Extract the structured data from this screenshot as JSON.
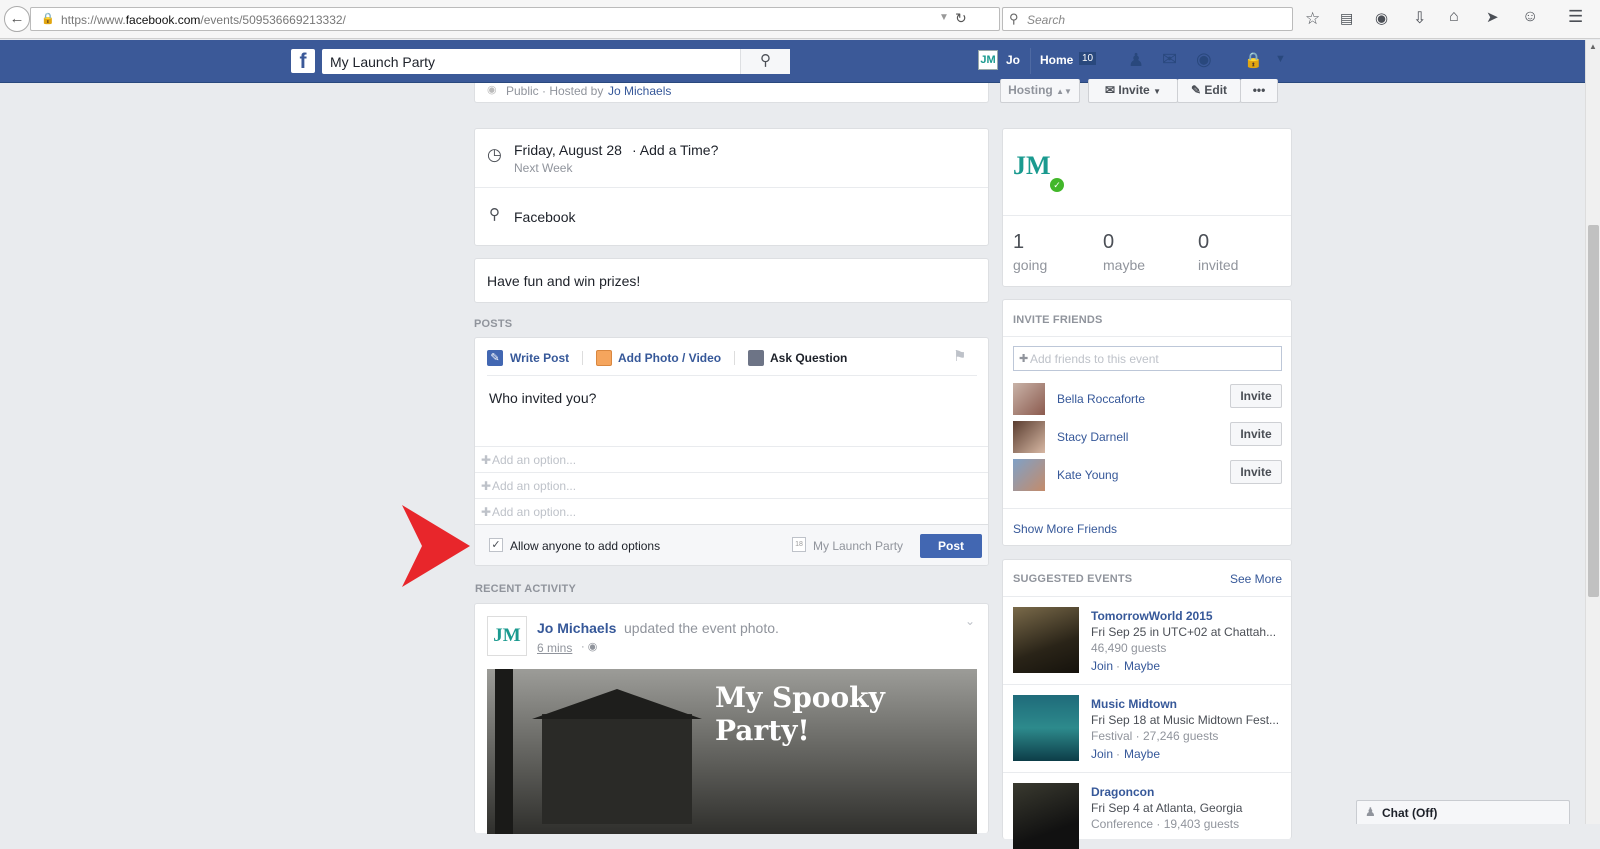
{
  "browser": {
    "url_prefix": "https://www.",
    "url_domain": "facebook.com",
    "url_path": "/events/509536669213332/",
    "search_placeholder": "Search"
  },
  "topbar": {
    "search_value": "My Launch Party",
    "user_name": "Jo",
    "home_label": "Home",
    "home_count": "10"
  },
  "event_header": {
    "privacy": "Public",
    "hosted_by_prefix": "· Hosted by",
    "host": "Jo Michaels",
    "hosting_label": "Hosting",
    "invite_label": "Invite",
    "edit_label": "Edit",
    "more_label": "•••"
  },
  "details": {
    "date": "Friday, August 28",
    "add_time": "· Add a Time?",
    "relative": "Next Week",
    "location": "Facebook",
    "description": "Have fun and win prizes!"
  },
  "posts": {
    "header": "POSTS",
    "tabs": [
      "Write Post",
      "Add Photo / Video",
      "Ask Question"
    ],
    "question": "Who invited you?",
    "option_placeholder": "Add an option...",
    "allow_label": "Allow anyone to add options",
    "target": "My Launch Party",
    "post_label": "Post"
  },
  "recent": {
    "header": "RECENT ACTIVITY",
    "author": "Jo Michaels",
    "action": "updated the event photo.",
    "time": "6 mins",
    "photo_text": "My Spooky Party!"
  },
  "stats": [
    {
      "count": "1",
      "label": "going"
    },
    {
      "count": "0",
      "label": "maybe"
    },
    {
      "count": "0",
      "label": "invited"
    }
  ],
  "invite_friends": {
    "header": "INVITE FRIENDS",
    "placeholder": "Add friends to this event",
    "friends": [
      {
        "name": "Bella Roccaforte",
        "button": "Invite"
      },
      {
        "name": "Stacy Darnell",
        "button": "Invite"
      },
      {
        "name": "Kate Young",
        "button": "Invite"
      }
    ],
    "show_more": "Show More Friends"
  },
  "suggested": {
    "header": "SUGGESTED EVENTS",
    "see_more": "See More",
    "events": [
      {
        "title": "TomorrowWorld 2015",
        "line1": "Fri Sep 25 in UTC+02 at Chattah...",
        "line2": "46,490 guests",
        "join": "Join",
        "maybe": "Maybe"
      },
      {
        "title": "Music Midtown",
        "line1": "Fri Sep 18 at Music Midtown Fest...",
        "line2": "Festival · 27,246 guests",
        "join": "Join",
        "maybe": "Maybe"
      },
      {
        "title": "Dragoncon",
        "line1": "Fri Sep 4 at Atlanta, Georgia",
        "line2": "Conference · 19,403 guests"
      }
    ]
  },
  "chat": {
    "label": "Chat (Off)"
  },
  "colors": {
    "fb_blue": "#3b5998",
    "link": "#365899",
    "arrow": "#e8262b",
    "online": "#42b72a"
  }
}
